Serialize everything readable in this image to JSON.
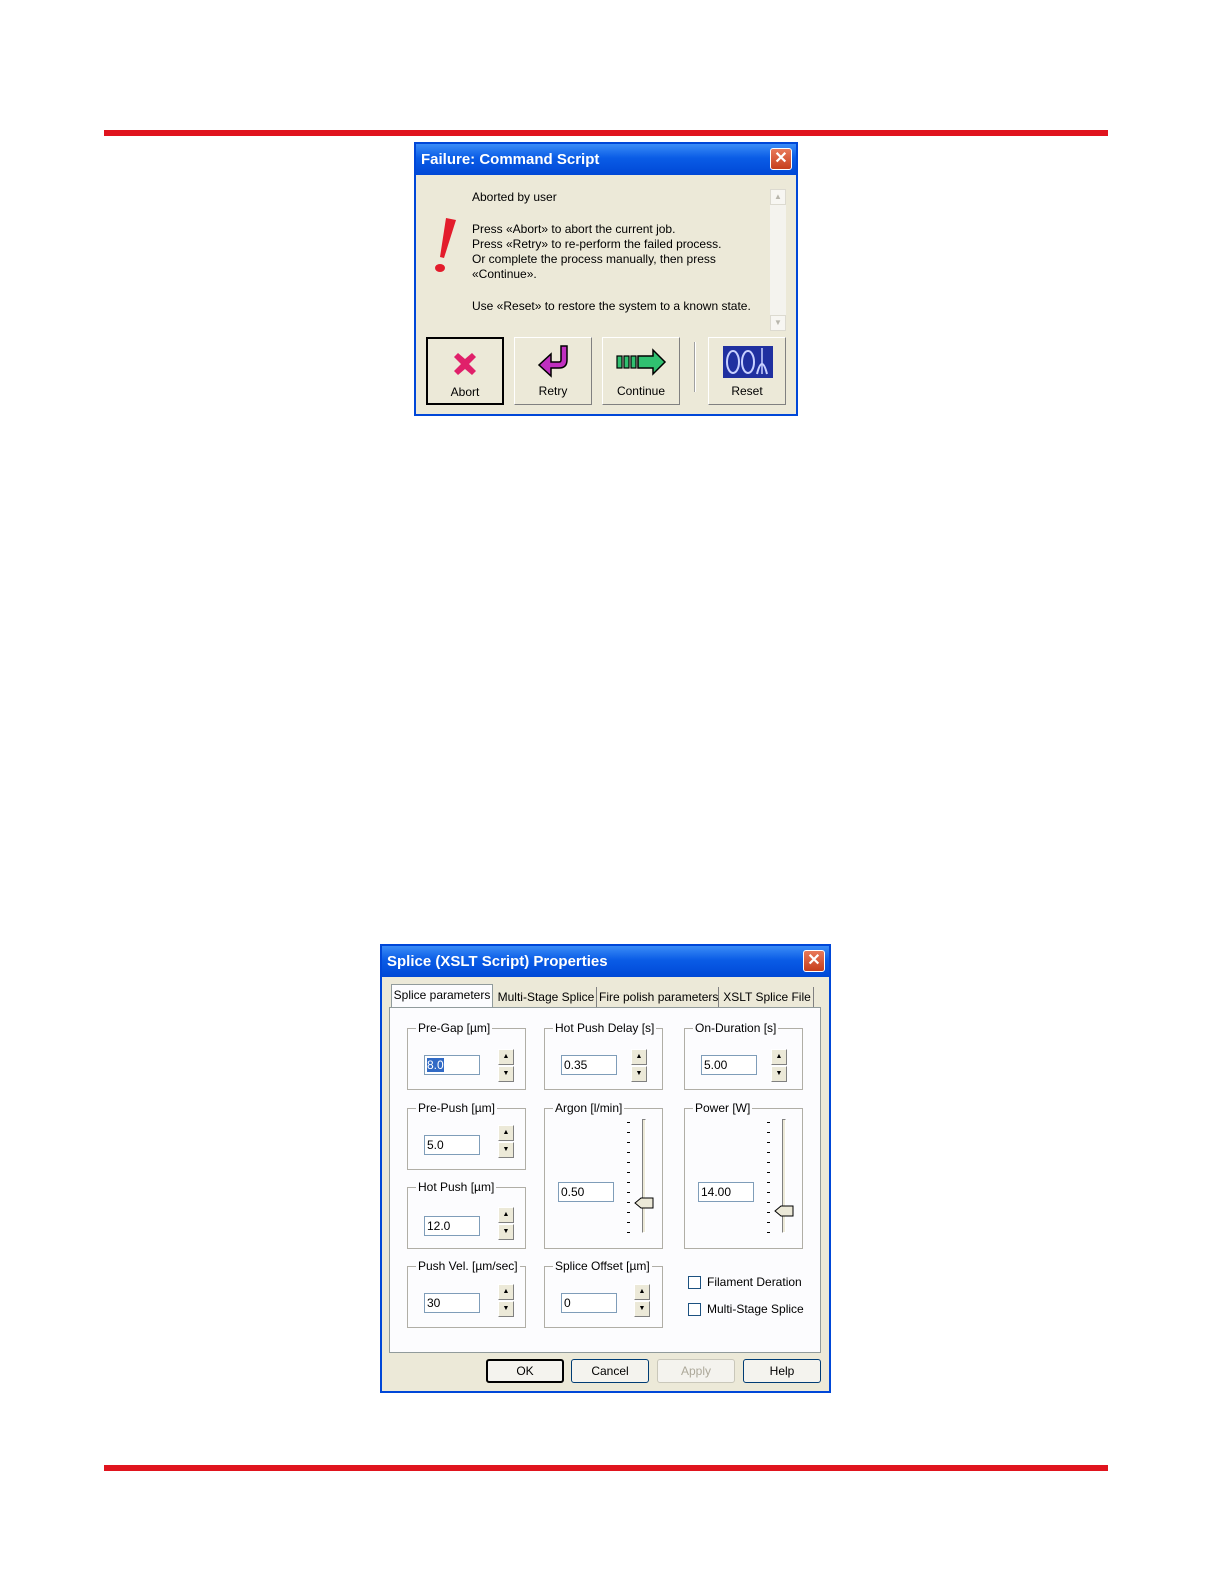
{
  "failure_dialog": {
    "title": "Failure: Command Script",
    "close_glyph": "✕",
    "icon": "exclamation-icon",
    "message_lines": [
      "Aborted by user",
      "Press «Abort» to abort the current job.",
      "Press «Retry» to re-perform the failed process.",
      "Or complete the process manually, then press",
      "«Continue».",
      "Use «Reset» to restore the system to a known state."
    ],
    "buttons": {
      "abort": "Abort",
      "retry": "Retry",
      "continue": "Continue",
      "reset": "Reset"
    },
    "colors": {
      "abort_icon": "#e0206a",
      "retry_icon": "#c030c0",
      "continue_icon": "#30c070",
      "reset_icon": "#2030a0"
    }
  },
  "splice_dialog": {
    "title": "Splice (XSLT Script) Properties",
    "close_glyph": "✕",
    "tabs": [
      "Splice parameters",
      "Multi-Stage Splice",
      "Fire polish parameters",
      "XSLT Splice File"
    ],
    "selected_tab": "Splice parameters",
    "fields": {
      "pre_gap": {
        "label": "Pre-Gap [µm]",
        "value": "8.0"
      },
      "hot_push_delay": {
        "label": "Hot Push Delay [s]",
        "value": "0.35"
      },
      "on_duration": {
        "label": "On-Duration [s]",
        "value": "5.00"
      },
      "pre_push": {
        "label": "Pre-Push [µm]",
        "value": "5.0"
      },
      "argon": {
        "label": "Argon [l/min]",
        "value": "0.50"
      },
      "power": {
        "label": "Power [W]",
        "value": "14.00"
      },
      "hot_push": {
        "label": "Hot Push [µm]",
        "value": "12.0"
      },
      "push_vel": {
        "label": "Push Vel. [µm/sec]",
        "value": "30"
      },
      "splice_offset": {
        "label": "Splice Offset [µm]",
        "value": "0"
      }
    },
    "checkboxes": {
      "filament_deration": {
        "label": "Filament Deration",
        "checked": false
      },
      "multi_stage_splice": {
        "label": "Multi-Stage Splice",
        "checked": false
      }
    },
    "buttons": {
      "ok": "OK",
      "cancel": "Cancel",
      "apply": "Apply",
      "help": "Help"
    }
  },
  "accent_colors": {
    "rule": "#e0141e",
    "titlebar": "#0a5ce6"
  }
}
